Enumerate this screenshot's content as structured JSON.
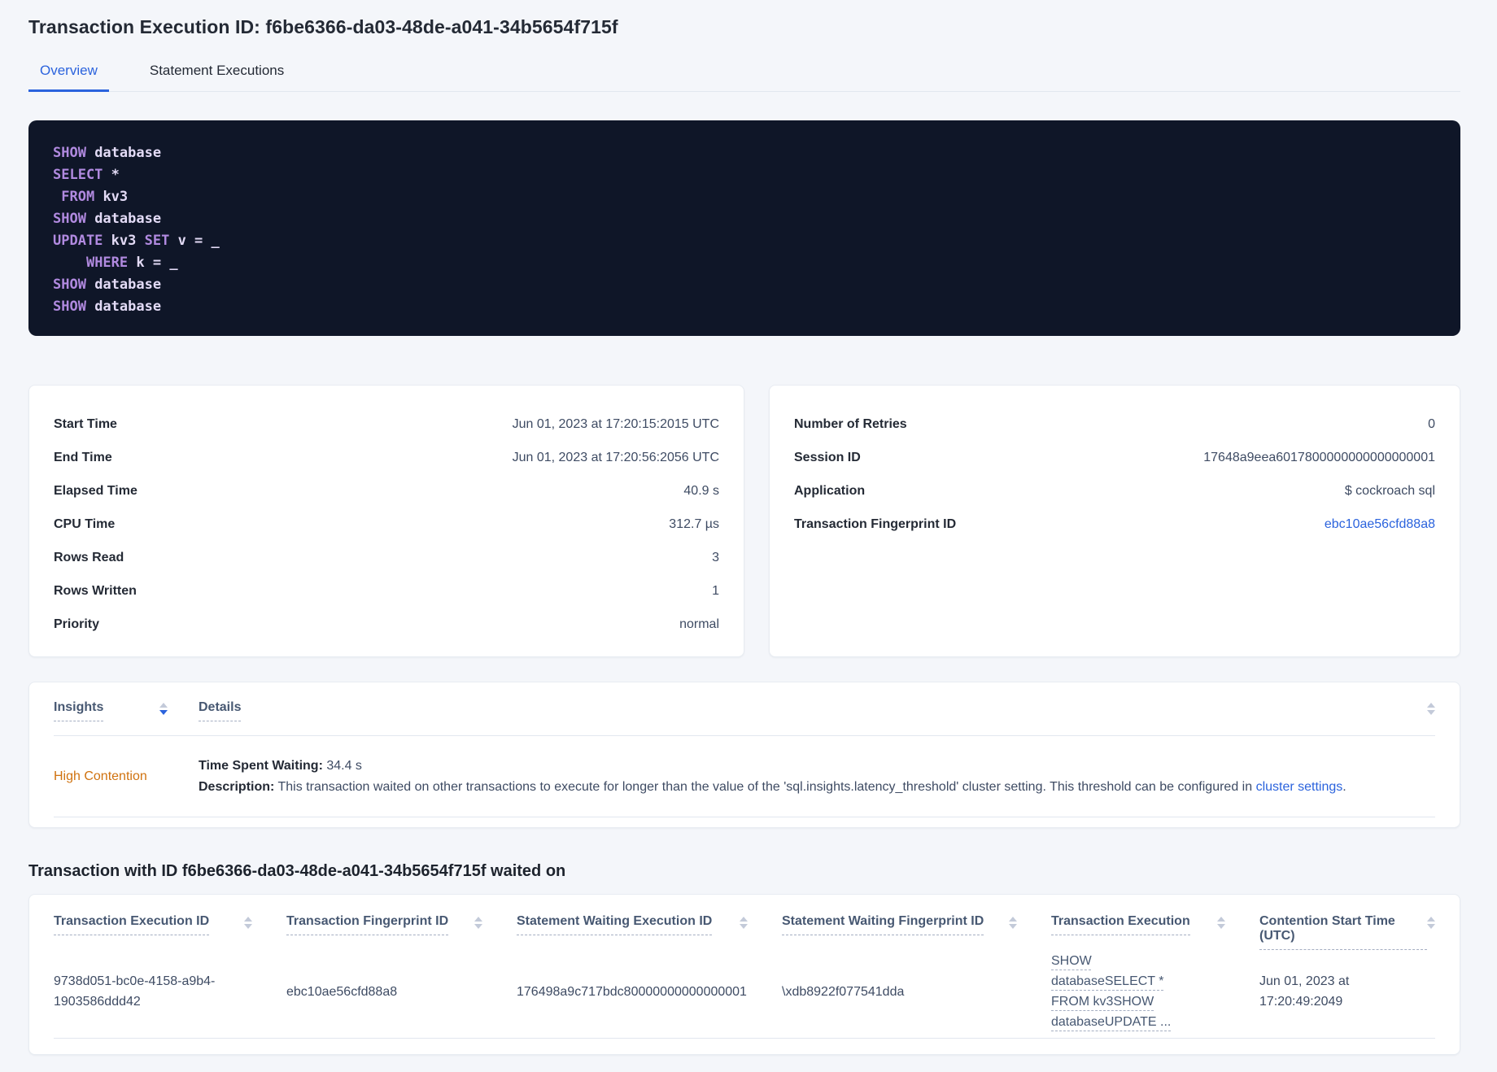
{
  "page": {
    "title": "Transaction Execution ID: f6be6366-da03-48de-a041-34b5654f715f",
    "tabs": {
      "overview": "Overview",
      "statement_executions": "Statement Executions"
    }
  },
  "sql": {
    "lines": [
      [
        [
          "k",
          "SHOW"
        ],
        [
          "p",
          " database"
        ]
      ],
      [
        [
          "k",
          "SELECT"
        ],
        [
          "p",
          " *"
        ]
      ],
      [
        [
          "p",
          " "
        ],
        [
          "k",
          "FROM"
        ],
        [
          "p",
          " kv3"
        ]
      ],
      [
        [
          "k",
          "SHOW"
        ],
        [
          "p",
          " database"
        ]
      ],
      [
        [
          "k",
          "UPDATE"
        ],
        [
          "p",
          " kv3 "
        ],
        [
          "k",
          "SET"
        ],
        [
          "p",
          " v = _"
        ]
      ],
      [
        [
          "p",
          "    "
        ],
        [
          "k",
          "WHERE"
        ],
        [
          "p",
          " k = _"
        ]
      ],
      [
        [
          "k",
          "SHOW"
        ],
        [
          "p",
          " database"
        ]
      ],
      [
        [
          "k",
          "SHOW"
        ],
        [
          "p",
          " database"
        ]
      ]
    ]
  },
  "left_stats": {
    "rows": [
      {
        "label": "Start Time",
        "value": "Jun 01, 2023 at 17:20:15:2015 UTC"
      },
      {
        "label": "End Time",
        "value": "Jun 01, 2023 at 17:20:56:2056 UTC"
      },
      {
        "label": "Elapsed Time",
        "value": "40.9 s"
      },
      {
        "label": "CPU Time",
        "value": "312.7 µs"
      },
      {
        "label": "Rows Read",
        "value": "3"
      },
      {
        "label": "Rows Written",
        "value": "1"
      },
      {
        "label": "Priority",
        "value": "normal"
      }
    ]
  },
  "right_stats": {
    "rows": [
      {
        "label": "Number of Retries",
        "value": "0"
      },
      {
        "label": "Session ID",
        "value": "17648a9eea6017800000000000000001"
      },
      {
        "label": "Application",
        "value": "$ cockroach sql"
      },
      {
        "label": "Transaction Fingerprint ID",
        "value": "ebc10ae56cfd88a8"
      }
    ]
  },
  "insights": {
    "columns": {
      "insights": "Insights",
      "details": "Details"
    },
    "row": {
      "insight": "High Contention",
      "waiting_label": "Time Spent Waiting:",
      "waiting_value": " 34.4 s",
      "description_label": "Description:",
      "description_text": " This transaction waited on other transactions to execute for longer than the value of the 'sql.insights.latency_threshold' cluster setting. This threshold can be configured in ",
      "description_link": "cluster settings",
      "description_suffix": "."
    }
  },
  "waited_on": {
    "heading": "Transaction with ID f6be6366-da03-48de-a041-34b5654f715f waited on",
    "columns": [
      "Transaction Execution ID",
      "Transaction Fingerprint ID",
      "Statement Waiting Execution ID",
      "Statement Waiting Fingerprint ID",
      "Transaction Execution",
      "Contention Start Time (UTC)"
    ],
    "row": {
      "txn_execution_id": "9738d051-bc0e-4158-a9b4-1903586ddd42",
      "txn_fingerprint_id": "ebc10ae56cfd88a8",
      "stmt_waiting_execution_id": "176498a9c717bdc80000000000000001",
      "stmt_waiting_fingerprint_id": "\\xdb8922f077541dda",
      "txn_execution": "SHOW databaseSELECT * FROM kv3SHOW databaseUPDATE ...",
      "contention_start": "Jun 01, 2023 at 17:20:49:2049"
    }
  },
  "colors": {
    "accent-blue": "#2b63dd",
    "warn-orange": "#d0720f",
    "code-bg": "#0f1628",
    "code-key": "#b18ae0",
    "code-plain": "#e3dbf6",
    "page-bg": "#f4f6fa"
  }
}
